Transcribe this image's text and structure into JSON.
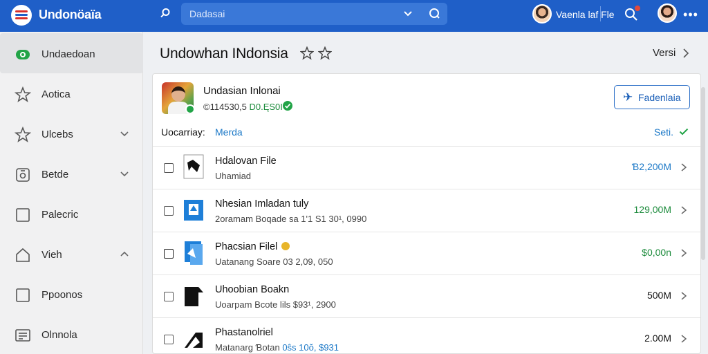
{
  "app": {
    "title": "Undonöaïa"
  },
  "search": {
    "placeholder": "Dadasai"
  },
  "user": {
    "name": "Vaenla laf Fle"
  },
  "sidebar": {
    "items": [
      {
        "label": "Undaedoan",
        "icon": "app-badge-icon",
        "active": true,
        "chevron": ""
      },
      {
        "label": "Aotica",
        "icon": "star-icon",
        "active": false,
        "chevron": ""
      },
      {
        "label": "Ulcebs",
        "icon": "star-icon",
        "active": false,
        "chevron": "down"
      },
      {
        "label": "Betde",
        "icon": "camera-icon",
        "active": false,
        "chevron": "down"
      },
      {
        "label": "Palecric",
        "icon": "square-icon",
        "active": false,
        "chevron": ""
      },
      {
        "label": "Vieh",
        "icon": "home-icon",
        "active": false,
        "chevron": "up"
      },
      {
        "label": "Ppoonos",
        "icon": "square-icon",
        "active": false,
        "chevron": ""
      },
      {
        "label": "Olnnola",
        "icon": "list-icon",
        "active": false,
        "chevron": ""
      }
    ]
  },
  "main": {
    "title": "Undowhan INdonsia",
    "version_label": "Versi",
    "app_card": {
      "name": "Undasian Inlonai",
      "meta_prefix": "©114530,5",
      "meta_value": "D0.ĘS0I",
      "favorite_label": "Fadenlaia",
      "category_label": "Uocarriay:",
      "category_link": "Merda",
      "select_label": "Seti."
    },
    "files": [
      {
        "title": "Hdalovan File",
        "subtitle_prefix": "Uhamiad",
        "subtitle_highlight": "",
        "size": "Ɓ2,200M",
        "size_color": "#1b78c7",
        "icon": "file-black-icon",
        "coin": false
      },
      {
        "title": "Nhesian Imladan tuly",
        "subtitle_prefix": "2oramam Boqade sa 1'1 S1 30¹, 0990",
        "subtitle_highlight": "",
        "size": "129,00M",
        "size_color": "#1a8a3a",
        "icon": "file-blue-icon",
        "coin": false
      },
      {
        "title": "Phacsian Filel",
        "subtitle_prefix": "Uatanang Soare 03 2,09, 050",
        "subtitle_highlight": "",
        "size": "$0,00n",
        "size_color": "#1a8a3a",
        "icon": "file-blue-icon",
        "coin": true
      },
      {
        "title": "Uhoobian Boakn",
        "subtitle_prefix": "Uoarpam Bcote  lils $93¹, 2900",
        "subtitle_highlight": "",
        "size": "500M",
        "size_color": "#111111",
        "icon": "file-black-icon",
        "coin": false
      },
      {
        "title": "Phastanolriel",
        "subtitle_prefix": "Matanarg Ɓotan",
        "subtitle_highlight": "0ŝs 10ŏ, $931",
        "size": "2.00M",
        "size_color": "#111111",
        "icon": "file-black-icon",
        "coin": false
      }
    ]
  },
  "colors": {
    "topbar": "#1f5fc8",
    "accent_blue": "#1b78c7",
    "accent_green": "#1a8a3a"
  }
}
